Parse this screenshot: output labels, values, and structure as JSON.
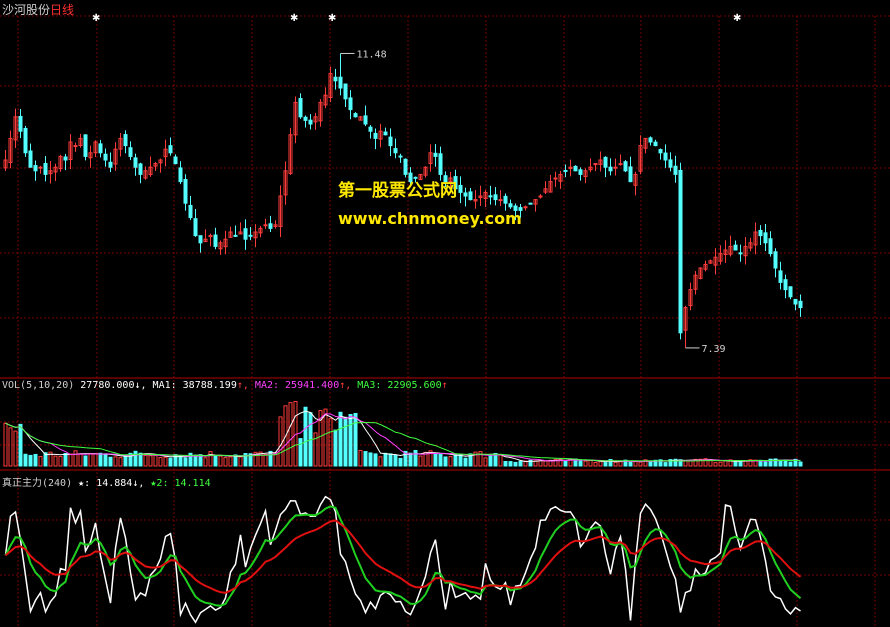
{
  "header": {
    "stock_name": "沙河股份",
    "timeframe": "日线"
  },
  "watermark": {
    "line1": "第一股票公式网",
    "line2": "www.chnmoney.com"
  },
  "colors": {
    "up": "#ff3c3c",
    "down": "#54ffff",
    "grid": "#7a0000",
    "ma1": "#ffffff",
    "ma2": "#ff40ff",
    "ma3": "#40ff40",
    "main_white": "#ffffff",
    "main_green": "#20d020",
    "main_red": "#e01010"
  },
  "chart_data": [
    {
      "type": "candlestick",
      "panel": "price",
      "high_annotation": "11.48",
      "low_annotation": "7.39",
      "ylim": [
        7.0,
        12.0
      ],
      "bars": 178,
      "closes": [
        10.0,
        10.3,
        10.6,
        10.4,
        10.1,
        9.9,
        9.85,
        9.9,
        9.8,
        9.85,
        9.9,
        10.05,
        10.0,
        10.25,
        10.2,
        10.3,
        10.05,
        10.1,
        10.25,
        10.1,
        10.0,
        9.9,
        10.15,
        10.3,
        10.2,
        10.05,
        9.9,
        9.8,
        9.85,
        9.9,
        9.95,
        10.0,
        10.15,
        10.1,
        9.95,
        9.7,
        9.4,
        9.2,
        8.95,
        8.85,
        8.9,
        8.95,
        8.8,
        8.85,
        8.9,
        9.0,
        8.95,
        9.0,
        8.9,
        8.95,
        9.0,
        9.05,
        9.1,
        9.05,
        9.1,
        9.5,
        9.85,
        10.35,
        10.8,
        10.6,
        10.55,
        10.5,
        10.6,
        10.8,
        10.9,
        11.2,
        11.1,
        11.0,
        10.85,
        10.7,
        10.6,
        10.6,
        10.5,
        10.4,
        10.3,
        10.4,
        10.35,
        10.2,
        10.1,
        10.05,
        9.8,
        9.7,
        9.75,
        9.8,
        9.9,
        10.1,
        10.05,
        9.8,
        9.7,
        9.75,
        9.6,
        9.55,
        9.5,
        9.45,
        9.45,
        9.5,
        9.55,
        9.5,
        9.45,
        9.45,
        9.4,
        9.35,
        9.3,
        9.3,
        9.35,
        9.4,
        9.45,
        9.5,
        9.6,
        9.7,
        9.75,
        9.8,
        9.85,
        9.9,
        9.85,
        9.8,
        9.85,
        9.9,
        9.95,
        10.0,
        9.9,
        9.85,
        9.9,
        9.95,
        9.85,
        9.7,
        9.8,
        10.2,
        10.3,
        10.25,
        10.2,
        10.1,
        10.0,
        9.9,
        9.8,
        7.6,
        7.95,
        8.2,
        8.4,
        8.5,
        8.55,
        8.6,
        8.65,
        8.7,
        8.75,
        8.8,
        8.75,
        8.7,
        8.8,
        8.85,
        9.0,
        8.95,
        8.85,
        8.7,
        8.5,
        8.3,
        8.2,
        8.1,
        8.0,
        7.95
      ]
    },
    {
      "type": "bar",
      "panel": "volume",
      "indicator": "VOL(5,10,20)",
      "value": "27780.000",
      "ma1_label": "MA1: 38788.199",
      "ma2_label": "MA2: 25941.400",
      "ma3_label": "MA3: 22905.600",
      "ylim": [
        0,
        80000
      ]
    },
    {
      "type": "line",
      "panel": "indicator",
      "indicator": "真正主力(240)",
      "star1_label": "★: 14.884",
      "star2_label": "★2: 14.114",
      "ylim": [
        0,
        100
      ]
    }
  ]
}
